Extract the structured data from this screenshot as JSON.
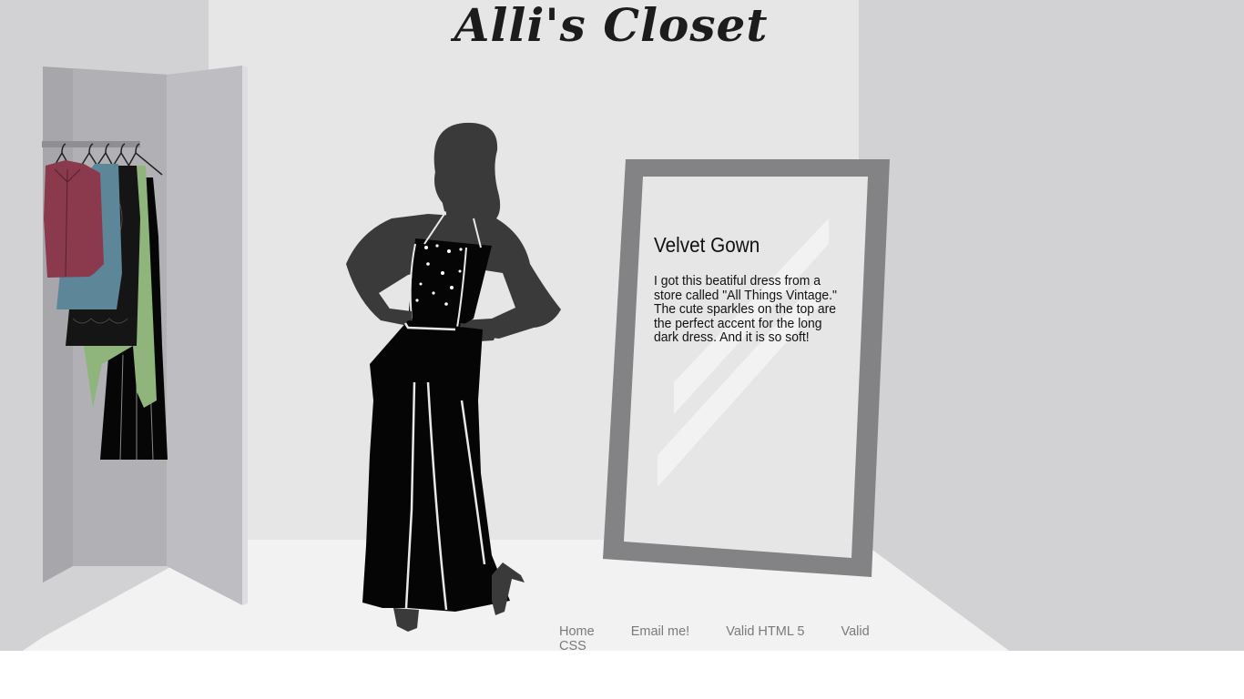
{
  "header": {
    "title": "Alli's Closet"
  },
  "item": {
    "title": "Velvet Gown",
    "description": "I got this beatiful dress from a store called \"All Things Vintage.\" The cute sparkles on the top are the perfect accent for the long dark dress. And it is so soft!"
  },
  "footer": {
    "links": [
      "Home",
      "Email me!",
      "Valid HTML 5",
      "Valid CSS"
    ]
  },
  "colors": {
    "wall": "#e6e6e6",
    "side_wall": "#d2d2d4",
    "floor": "#f2f2f2",
    "mirror_frame": "#838385",
    "silhouette": "#3a3a3a",
    "dress": "#050505"
  }
}
